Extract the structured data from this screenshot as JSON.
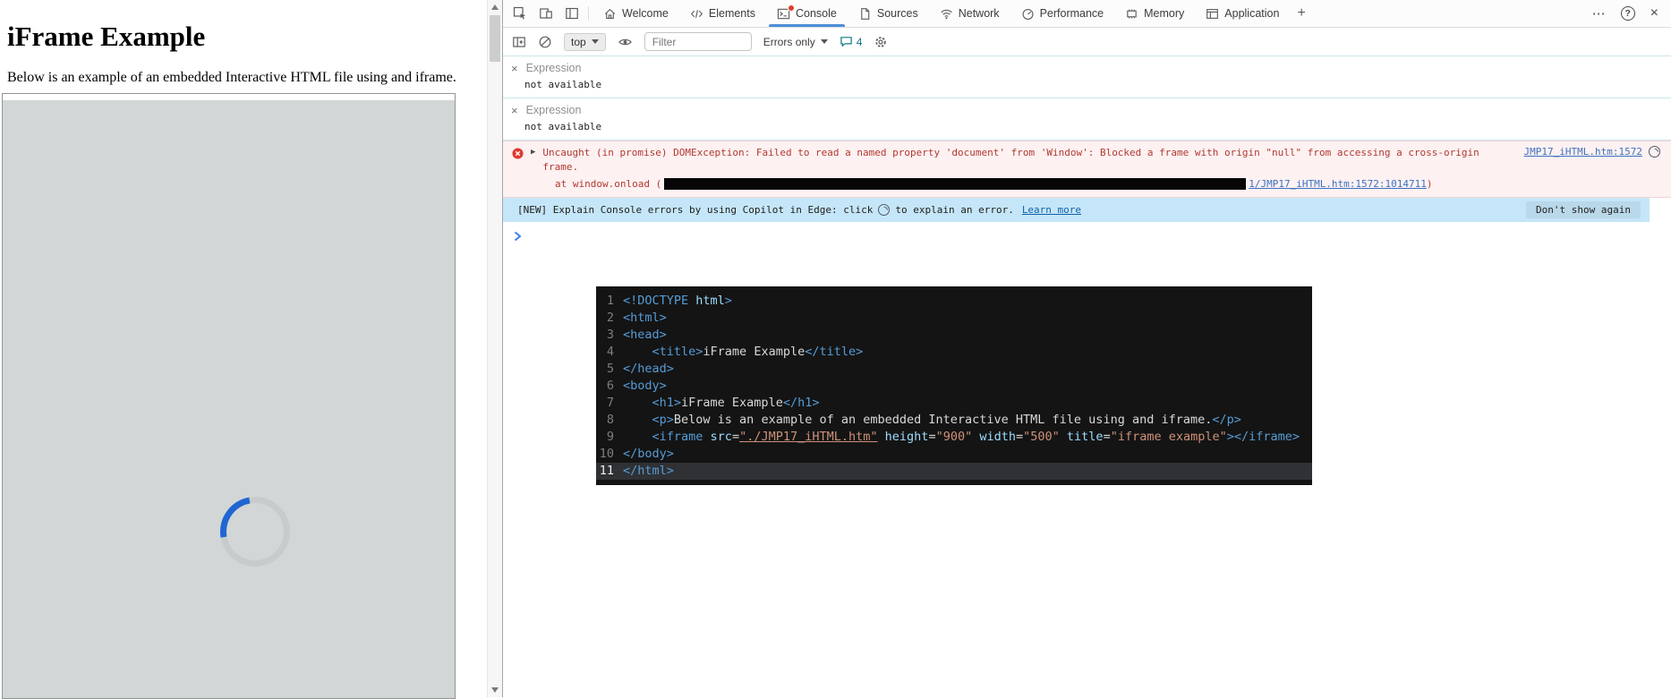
{
  "theme": {
    "accent_blue": "#4e8ed9",
    "error_red": "#b13a2f",
    "error_bg": "#fdf1f2",
    "banner_bg": "#c5e6f8",
    "code_bg": "#141414",
    "iframe_gray": "#d2d6d7",
    "spinner_blue": "#2066d2",
    "expression_separator": "#c9e6ea"
  },
  "icons": {
    "close": "×",
    "more": "⋯",
    "help": "?",
    "add_tab": "+",
    "remove_expression": "×",
    "expand_caret": "▶"
  },
  "page": {
    "heading": "iFrame Example",
    "description": "Below is an example of an embedded Interactive HTML file using and iframe."
  },
  "devtools": {
    "tabs": [
      {
        "label": "Welcome"
      },
      {
        "label": "Elements"
      },
      {
        "label": "Console"
      },
      {
        "label": "Sources"
      },
      {
        "label": "Network"
      },
      {
        "label": "Performance"
      },
      {
        "label": "Memory"
      },
      {
        "label": "Application"
      }
    ],
    "toolbar": {
      "context": "top",
      "filter_placeholder": "Filter",
      "level_filter": "Errors only",
      "message_count": "4"
    },
    "expressions": [
      {
        "label": "Expression",
        "value": "not available"
      },
      {
        "label": "Expression",
        "value": "not available"
      }
    ],
    "error": {
      "message": "Uncaught (in promise) DOMException: Failed to read a named property 'document' from 'Window': Blocked a frame with origin \"null\" from accessing a cross-origin frame.",
      "source_link": "JMP17_iHTML.htm:1572",
      "stack_prefix": "at window.onload (",
      "stack_link": "1/JMP17_iHTML.htm:1572:1014711",
      "stack_close": ")"
    },
    "banner": {
      "text_before": "[NEW] Explain Console errors by using Copilot in Edge: click",
      "text_after": "to explain an error.",
      "learn_more": "Learn more",
      "dismiss_button": "Don't show again"
    },
    "code_block": {
      "lines": [
        {
          "num": "1",
          "segments": [
            [
              "t",
              "<!DOCTYPE "
            ],
            [
              "a",
              "html"
            ],
            [
              "t",
              ">"
            ]
          ]
        },
        {
          "num": "2",
          "segments": [
            [
              "t",
              "<html>"
            ]
          ]
        },
        {
          "num": "3",
          "segments": [
            [
              "t",
              "<head>"
            ]
          ]
        },
        {
          "num": "4",
          "segments": [
            [
              "x",
              "    "
            ],
            [
              "t",
              "<title>"
            ],
            [
              "x",
              "iFrame Example"
            ],
            [
              "t",
              "</title>"
            ]
          ]
        },
        {
          "num": "5",
          "segments": [
            [
              "t",
              "</head>"
            ]
          ]
        },
        {
          "num": "6",
          "segments": [
            [
              "t",
              "<body>"
            ]
          ]
        },
        {
          "num": "7",
          "segments": [
            [
              "x",
              "    "
            ],
            [
              "t",
              "<h1>"
            ],
            [
              "x",
              "iFrame Example"
            ],
            [
              "t",
              "</h1>"
            ]
          ]
        },
        {
          "num": "8",
          "segments": [
            [
              "x",
              "    "
            ],
            [
              "t",
              "<p>"
            ],
            [
              "x",
              "Below is an example of an embedded Interactive HTML file using and iframe."
            ],
            [
              "t",
              "</p>"
            ]
          ]
        },
        {
          "num": "9",
          "segments": [
            [
              "x",
              "    "
            ],
            [
              "t",
              "<iframe "
            ],
            [
              "a",
              "src"
            ],
            [
              "x",
              "="
            ],
            [
              "u",
              "\"./JMP17_iHTML.htm\""
            ],
            [
              "x",
              " "
            ],
            [
              "a",
              "height"
            ],
            [
              "x",
              "="
            ],
            [
              "s",
              "\"900\""
            ],
            [
              "x",
              " "
            ],
            [
              "a",
              "width"
            ],
            [
              "x",
              "="
            ],
            [
              "s",
              "\"500\""
            ],
            [
              "x",
              " "
            ],
            [
              "a",
              "title"
            ],
            [
              "x",
              "="
            ],
            [
              "s",
              "\"iframe example\""
            ],
            [
              "t",
              "></iframe>"
            ]
          ]
        },
        {
          "num": "10",
          "segments": [
            [
              "t",
              "</body>"
            ]
          ]
        },
        {
          "num": "11",
          "highlight": true,
          "segments": [
            [
              "t",
              "</html>"
            ]
          ]
        }
      ]
    }
  }
}
